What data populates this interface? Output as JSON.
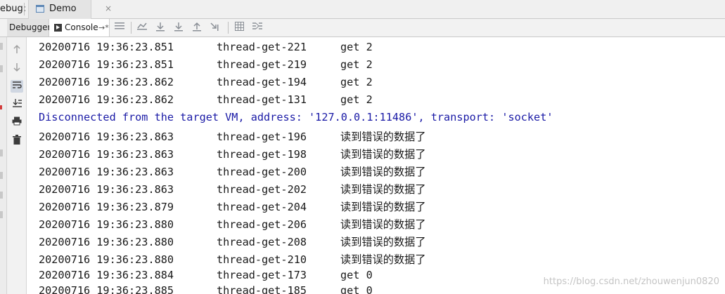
{
  "header": {
    "debug_label": "ebug:",
    "tab_label": "Demo",
    "tab_close": "×"
  },
  "toolbar": {
    "debugger_label": "Debugger",
    "console_label": "Console",
    "restore_glyph": "→*"
  },
  "console": {
    "lines": [
      {
        "timestamp": "20200716 19:36:23.851",
        "thread": "thread-get-221",
        "message": "get 2"
      },
      {
        "timestamp": "20200716 19:36:23.851",
        "thread": "thread-get-219",
        "message": "get 2"
      },
      {
        "timestamp": "20200716 19:36:23.862",
        "thread": "thread-get-194",
        "message": "get 2"
      },
      {
        "timestamp": "20200716 19:36:23.862",
        "thread": "thread-get-131",
        "message": "get 2"
      },
      {
        "system": "Disconnected from the target VM, address: '127.0.0.1:11486', transport: 'socket'"
      },
      {
        "timestamp": "20200716 19:36:23.863",
        "thread": "thread-get-196",
        "message": "读到错误的数据了"
      },
      {
        "timestamp": "20200716 19:36:23.863",
        "thread": "thread-get-198",
        "message": "读到错误的数据了"
      },
      {
        "timestamp": "20200716 19:36:23.863",
        "thread": "thread-get-200",
        "message": "读到错误的数据了"
      },
      {
        "timestamp": "20200716 19:36:23.863",
        "thread": "thread-get-202",
        "message": "读到错误的数据了"
      },
      {
        "timestamp": "20200716 19:36:23.879",
        "thread": "thread-get-204",
        "message": "读到错误的数据了"
      },
      {
        "timestamp": "20200716 19:36:23.880",
        "thread": "thread-get-206",
        "message": "读到错误的数据了"
      },
      {
        "timestamp": "20200716 19:36:23.880",
        "thread": "thread-get-208",
        "message": "读到错误的数据了"
      },
      {
        "timestamp": "20200716 19:36:23.880",
        "thread": "thread-get-210",
        "message": "读到错误的数据了"
      },
      {
        "timestamp": "20200716 19:36:23.884",
        "thread": "thread-get-173",
        "message": "get 0"
      },
      {
        "timestamp": "20200716 19:36:23.885",
        "thread": "thread-get-185",
        "message": "get 0"
      }
    ]
  },
  "watermark": "https://blog.csdn.net/zhouwenjun0820",
  "colors": {
    "system_text": "#1a1aa6",
    "normal_text": "#1a1a1a"
  }
}
